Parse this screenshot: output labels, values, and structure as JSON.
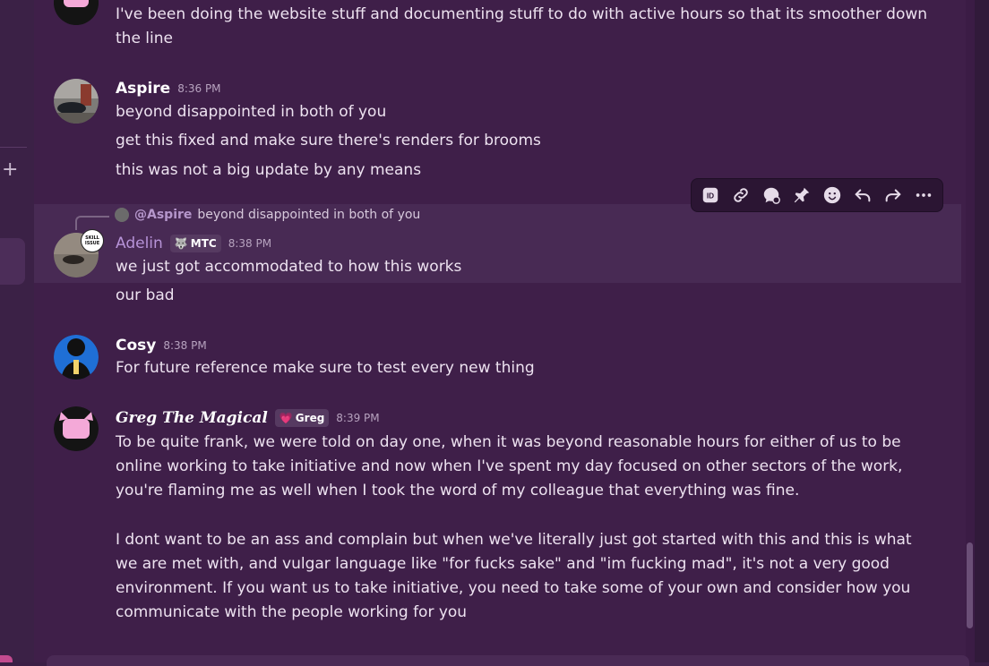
{
  "messages": {
    "top": {
      "line1": "I've been doing the website stuff and documenting stuff to do with active hours so that its smoother down",
      "line2": "the line"
    },
    "aspire": {
      "name": "Aspire",
      "timestamp": "8:36 PM",
      "lines": [
        "beyond disappointed in both of you",
        "get this fixed and make sure there's renders for brooms",
        "this was not a big update by any means"
      ]
    },
    "adelin": {
      "reply_mention": "@Aspire",
      "reply_text": "beyond disappointed in both of you",
      "name": "Adelin",
      "tag": "MTC",
      "timestamp": "8:38 PM",
      "avatar_badge": "SKILL ISSUE",
      "lines": [
        "we just got accommodated to how this works",
        "our bad"
      ]
    },
    "cosy": {
      "name": "Cosy",
      "timestamp": "8:38 PM",
      "lines": [
        "For future reference make sure to test every new thing"
      ]
    },
    "greg": {
      "name": "Greg The Magical",
      "tag": "Greg",
      "timestamp": "8:39 PM",
      "paragraph1": "To be quite frank, we were told on day one, when it was beyond reasonable hours for either of us to be online working to take initiative and now when I've spent my day focused on other sectors of the work, you're flaming me as well when I took the word of my colleague that everything was fine.",
      "paragraph2": "I dont want to be an ass and complain but when we've literally just got started with this and this is what we are met with, and vulgar language like \"for fucks sake\" and \"im fucking mad\", it's not a very good environment. If you want us to take initiative, you need to take some of your own and consider how you communicate with the people working for you"
    }
  },
  "toolbar": {
    "icons": [
      "id-icon",
      "link-icon",
      "thread-icon",
      "pin-icon",
      "emoji-icon",
      "reply-icon",
      "forward-icon",
      "more-icon"
    ]
  },
  "sidebar": {
    "plus": "+"
  },
  "colors": {
    "background": "#3f1f49",
    "hover": "#482a54",
    "accent_name": "#b793d8"
  }
}
